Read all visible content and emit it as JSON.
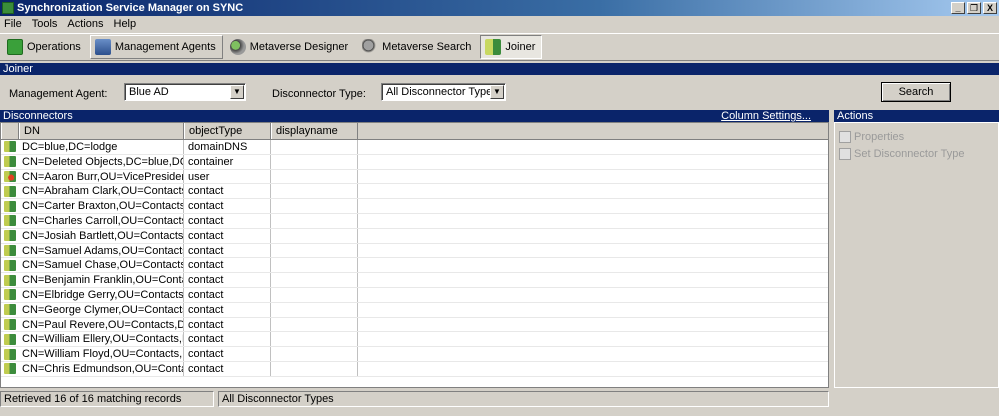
{
  "window": {
    "title": "Synchronization Service Manager on SYNC",
    "controls": [
      "_",
      "❐",
      "X"
    ]
  },
  "menu": [
    "File",
    "Tools",
    "Actions",
    "Help"
  ],
  "toolbar": [
    {
      "label": "Operations",
      "icon": "operations-icon"
    },
    {
      "label": "Management Agents",
      "icon": "management-agents-icon"
    },
    {
      "label": "Metaverse Designer",
      "icon": "metaverse-designer-icon"
    },
    {
      "label": "Metaverse Search",
      "icon": "metaverse-search-icon"
    },
    {
      "label": "Joiner",
      "icon": "joiner-icon",
      "active": true
    }
  ],
  "joiner": {
    "section_title": "Joiner",
    "management_agent_label": "Management Agent:",
    "management_agent_value": "Blue AD",
    "disconnector_type_label": "Disconnector Type:",
    "disconnector_type_value": "All Disconnector Types",
    "search_label": "Search"
  },
  "disconnectors": {
    "section_title": "Disconnectors",
    "column_settings": "Column Settings...",
    "columns": [
      "DN",
      "objectType",
      "displayname"
    ],
    "rows": [
      {
        "dn": "DC=blue,DC=lodge",
        "type": "domainDNS",
        "icon": "object"
      },
      {
        "dn": "CN=Deleted Objects,DC=blue,DC=l...",
        "type": "container",
        "icon": "object"
      },
      {
        "dn": "CN=Aaron Burr,OU=VicePresidents,...",
        "type": "user",
        "icon": "user"
      },
      {
        "dn": "CN=Abraham Clark,OU=Contacts,D...",
        "type": "contact",
        "icon": "object"
      },
      {
        "dn": "CN=Carter Braxton,OU=Contacts,D...",
        "type": "contact",
        "icon": "object"
      },
      {
        "dn": "CN=Charles Carroll,OU=Contacts,D...",
        "type": "contact",
        "icon": "object"
      },
      {
        "dn": "CN=Josiah Bartlett,OU=Contacts,D...",
        "type": "contact",
        "icon": "object"
      },
      {
        "dn": "CN=Samuel Adams,OU=Contacts,D...",
        "type": "contact",
        "icon": "object"
      },
      {
        "dn": "CN=Samuel Chase,OU=Contacts,D...",
        "type": "contact",
        "icon": "object"
      },
      {
        "dn": "CN=Benjamin Franklin,OU=Contact...",
        "type": "contact",
        "icon": "object"
      },
      {
        "dn": "CN=Elbridge Gerry,OU=Contacts,D...",
        "type": "contact",
        "icon": "object"
      },
      {
        "dn": "CN=George Clymer,OU=Contacts,D...",
        "type": "contact",
        "icon": "object"
      },
      {
        "dn": "CN=Paul Revere,OU=Contacts,DC...",
        "type": "contact",
        "icon": "object"
      },
      {
        "dn": "CN=William Ellery,OU=Contacts,DC...",
        "type": "contact",
        "icon": "object"
      },
      {
        "dn": "CN=William Floyd,OU=Contacts,DC...",
        "type": "contact",
        "icon": "object"
      },
      {
        "dn": "CN=Chris Edmundson,OU=Contact...",
        "type": "contact",
        "icon": "object"
      }
    ]
  },
  "actions": {
    "title": "Actions",
    "items": [
      "Properties",
      "Set Disconnector Type"
    ]
  },
  "status": {
    "records": "Retrieved 16 of 16 matching records",
    "filter": "All Disconnector Types"
  }
}
